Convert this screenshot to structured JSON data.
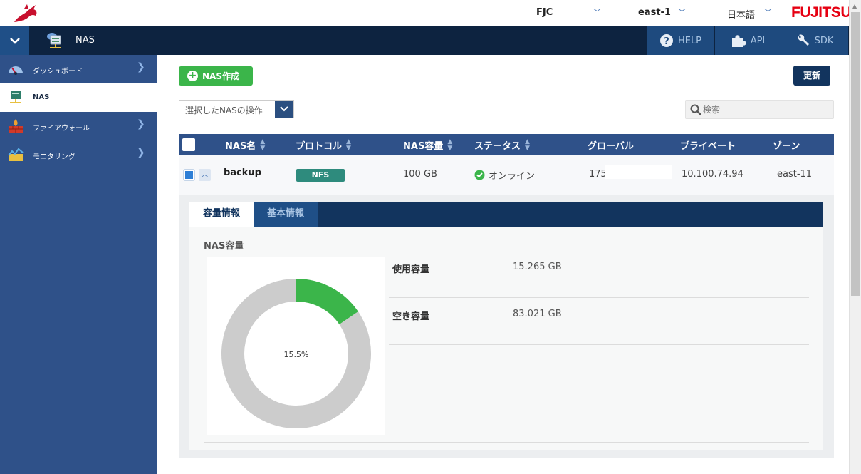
{
  "topbar": {
    "org": "FJC",
    "region": "east-1",
    "language": "日本語",
    "brand": "FUJITSU"
  },
  "navbar": {
    "page_title": "NAS",
    "help_label": "HELP",
    "api_label": "API",
    "sdk_label": "SDK"
  },
  "sidebar": {
    "items": [
      {
        "label": "ダッシュボード",
        "icon": "speedometer-icon"
      },
      {
        "label": "NAS",
        "icon": "nas-icon"
      },
      {
        "label": "ファイアウォール",
        "icon": "firewall-icon"
      },
      {
        "label": "モニタリング",
        "icon": "monitoring-icon"
      }
    ]
  },
  "toolbar": {
    "create_label": "NAS作成",
    "refresh_label": "更新",
    "operation_select": "選択したNASの操作",
    "search_placeholder": "検索"
  },
  "table": {
    "headers": [
      "NAS名",
      "プロトコル",
      "NAS容量",
      "ステータス",
      "グローバル",
      "プライベート",
      "ゾーン"
    ],
    "rows": [
      {
        "name": "backup",
        "protocol": "NFS",
        "capacity": "100 GB",
        "status": "オンライン",
        "global_ip": "175.",
        "private_ip": "10.100.74.94",
        "zone": "east-11"
      }
    ]
  },
  "detail": {
    "tabs": [
      "容量情報",
      "基本情報"
    ],
    "section_title": "NAS容量",
    "used_label": "使用容量",
    "used_value": "15.265 GB",
    "free_label": "空き容量",
    "free_value": "83.021 GB",
    "usage_percent_label": "15.5%"
  },
  "chart_data": {
    "type": "pie",
    "categories": [
      "使用容量",
      "空き容量"
    ],
    "values": [
      15.265,
      83.021
    ],
    "center_label": "15.5%",
    "colors": [
      "#3bb54a",
      "#cccccc"
    ]
  },
  "colors": {
    "sidebar": "#2f5189",
    "navbar": "#0d2340",
    "accent_green": "#3bb54a",
    "nfs_badge": "#2e8b7d",
    "brand_red": "#e60012"
  }
}
